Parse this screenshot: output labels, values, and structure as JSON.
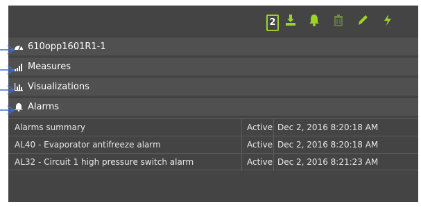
{
  "toolbar": {
    "badge": "2",
    "icons": [
      "download-icon",
      "bell-icon",
      "trash-icon",
      "pencil-icon",
      "bolt-icon"
    ],
    "accent": "#9bd427"
  },
  "tree": {
    "device": "610opp1601R1-1",
    "measures": "Measures",
    "visualizations": "Visualizations",
    "alarms": "Alarms"
  },
  "alarms_table": {
    "rows": [
      {
        "name": "Alarms summary",
        "status": "Active",
        "time": "Dec 2, 2016 8:20:18 AM"
      },
      {
        "name": "AL40 - Evaporator antifreeze alarm",
        "status": "Active",
        "time": "Dec 2, 2016 8:20:18 AM"
      },
      {
        "name": "AL32 - Circuit 1 high pressure switch alarm",
        "status": "Active",
        "time": "Dec 2, 2016 8:21:23 AM"
      }
    ]
  }
}
